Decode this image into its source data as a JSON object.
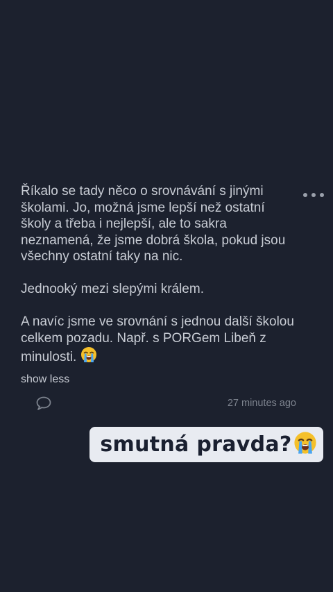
{
  "post": {
    "paragraphs": [
      "Říkalo se tady něco o srovnávání s jinými školami. Jo, možná jsme lepší než ostatní školy a třeba i nejlepší, ale to sakra neznamená, že jsme dobrá škola, pokud jsou všechny ostatní taky na nic.",
      "Jednooký mezi slepými králem.",
      "A navíc jsme ve srovnání s jednou další školou celkem pozadu. Např. s PORGem Libeň z minulosti."
    ],
    "trailing_emoji": "loudly-crying-face-icon",
    "show_less_label": "show less",
    "more_icon": "more-dots-icon",
    "comment_icon": "comment-bubble-icon",
    "timestamp": "27 minutes ago"
  },
  "sticker": {
    "text": "smutná pravda?",
    "emoji": "loudly-crying-face-icon",
    "background": "#e8ebf1"
  },
  "colors": {
    "background": "#1c212e",
    "body_text": "#c8ccd4",
    "muted_text": "#7d838e"
  }
}
